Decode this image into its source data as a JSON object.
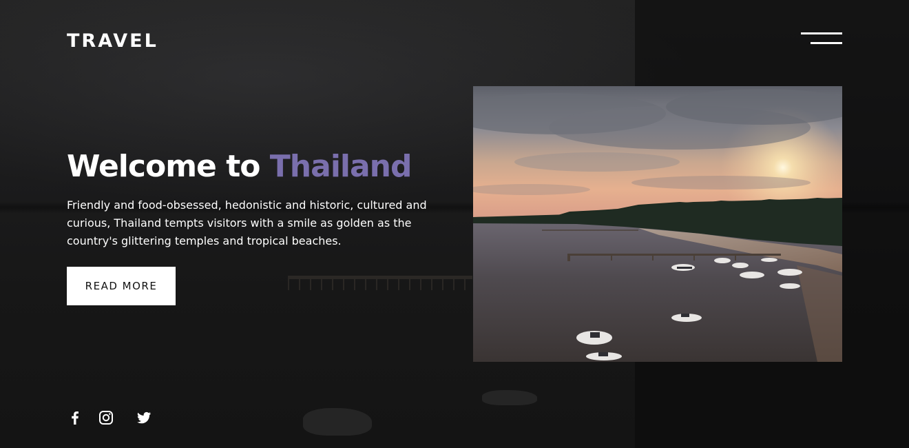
{
  "header": {
    "logo": "TRAVEL",
    "menu_icon": "hamburger-menu-icon"
  },
  "hero": {
    "title_prefix": "Welcome to",
    "title_accent": "Thailand",
    "description": "Friendly and food-obsessed, hedonistic and historic, cultured and curious, Thailand tempts visitors with a smile as golden as the country's glittering temples and tropical beaches.",
    "cta_label": "READ MORE",
    "image_description_icon": "sunset-bay-photo"
  },
  "socials": [
    {
      "icon": "facebook-icon"
    },
    {
      "icon": "instagram-icon"
    },
    {
      "icon": "twitter-icon"
    }
  ],
  "colors": {
    "accent": "#7a6fad",
    "background": "#151515",
    "text": "#ffffff",
    "button_bg": "#ffffff",
    "button_text": "#111111"
  }
}
